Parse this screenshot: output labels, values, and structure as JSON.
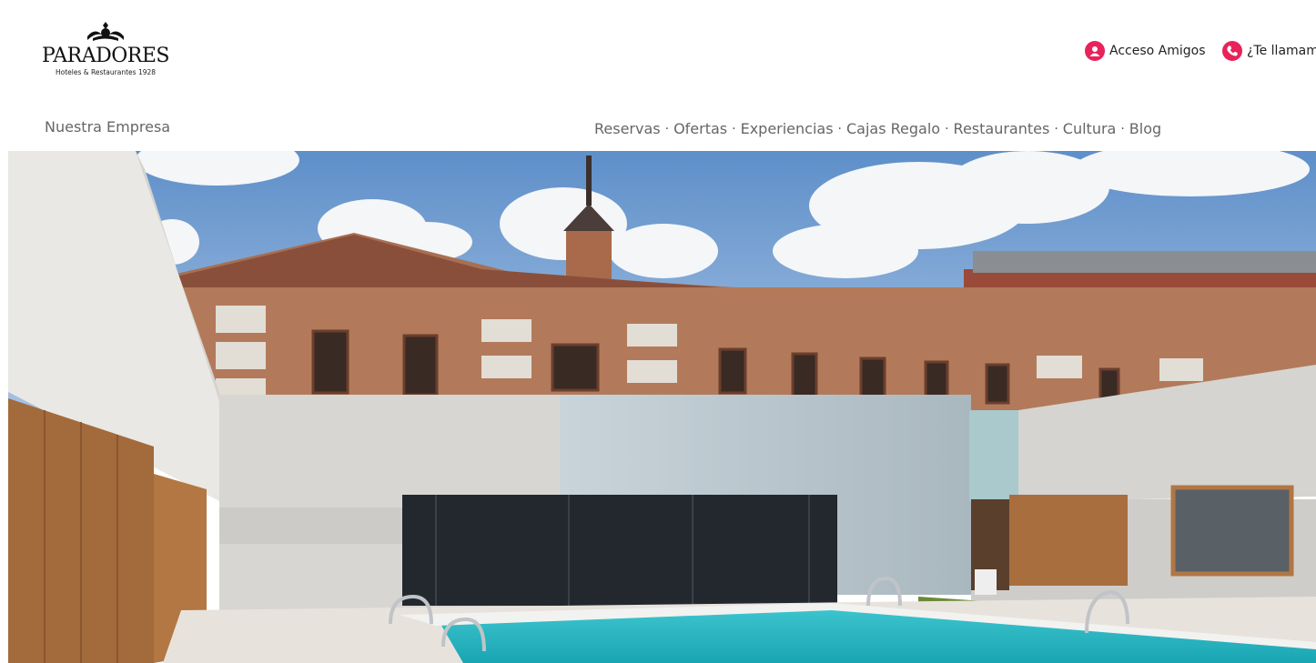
{
  "brand": {
    "name": "PARADORES",
    "tagline": "Hoteles & Restaurantes 1928"
  },
  "header": {
    "friends_label": "Acceso Amigos",
    "callback_label": "¿Te llamam"
  },
  "nav": {
    "company_label": "Nuestra Empresa",
    "items": [
      {
        "label": "Reservas"
      },
      {
        "label": "Ofertas"
      },
      {
        "label": "Experiencias"
      },
      {
        "label": "Cajas Regalo"
      },
      {
        "label": "Restaurantes"
      },
      {
        "label": "Cultura"
      },
      {
        "label": "Blog"
      }
    ],
    "separator": "·"
  },
  "colors": {
    "accent": "#e8235a",
    "nav_text": "#666666"
  },
  "icons": {
    "friends": "user-icon",
    "callback": "phone-icon"
  }
}
